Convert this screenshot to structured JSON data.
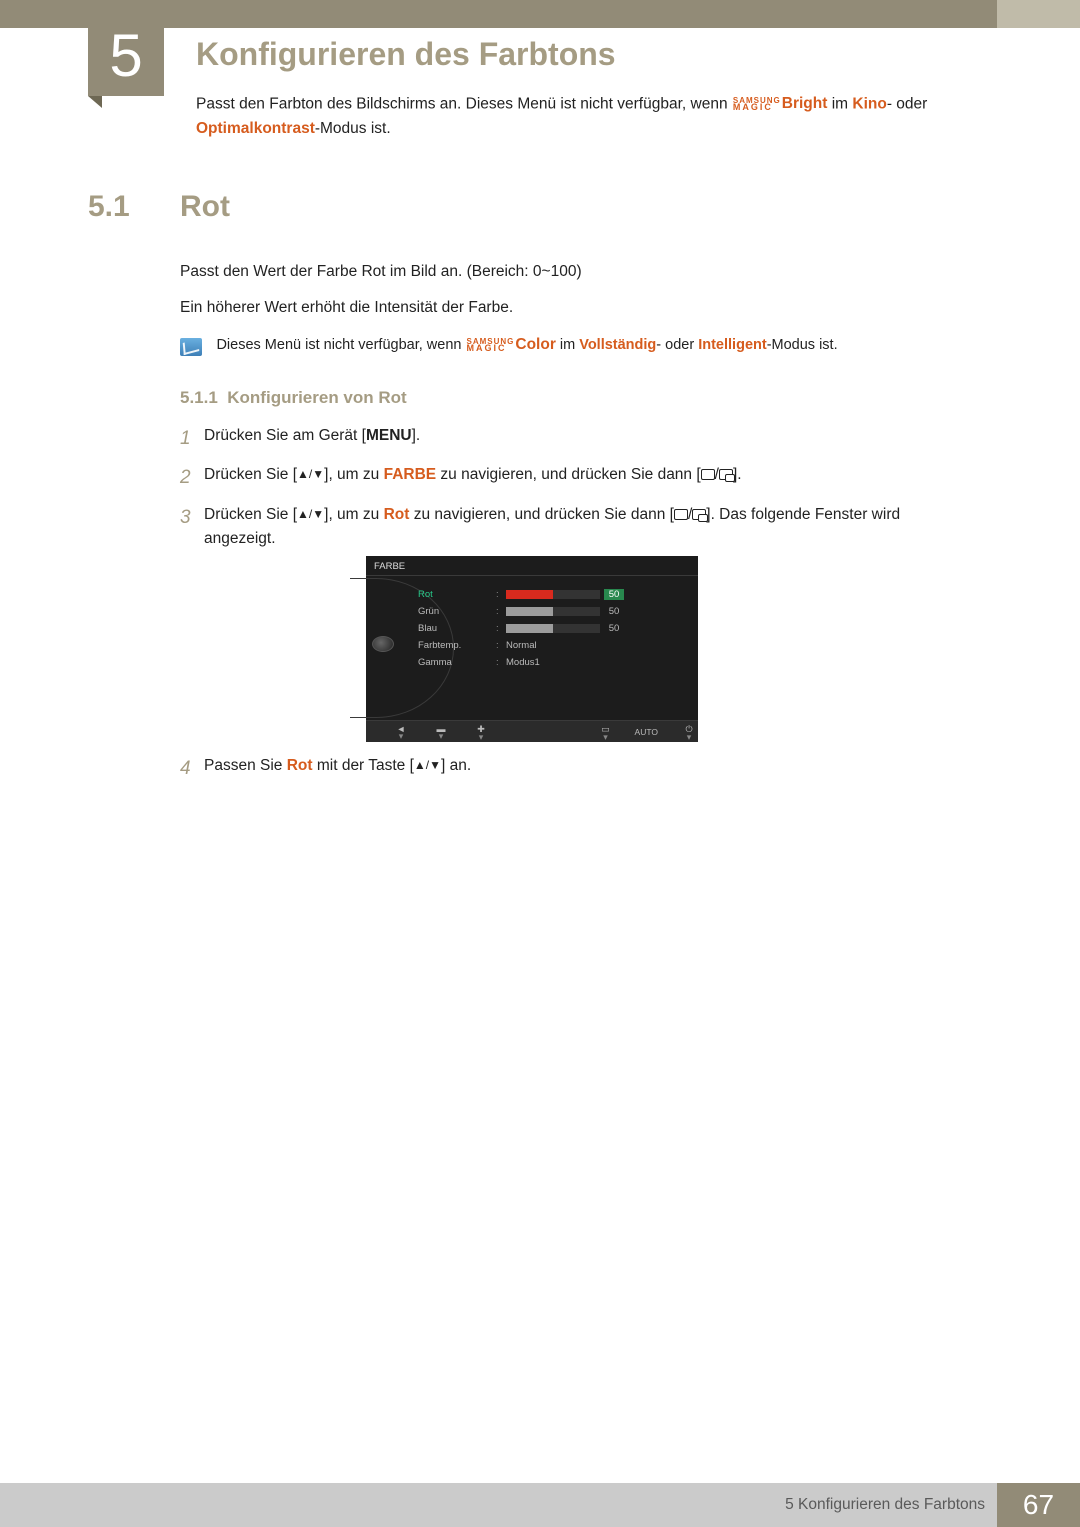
{
  "chapter": {
    "number": "5",
    "title": "Konfigurieren des Farbtons"
  },
  "intro": {
    "t1": "Passt den Farbton des Bildschirms an. Dieses Menü ist nicht verfügbar, wenn ",
    "magic_label": "Bright",
    "t2": " im ",
    "kino": "Kino",
    "t3": "- oder ",
    "optimal": "Optimalkontrast",
    "t4": "-Modus ist."
  },
  "section": {
    "number": "5.1",
    "title": "Rot"
  },
  "p1": "Passt den Wert der Farbe Rot im Bild an. (Bereich: 0~100)",
  "p2": "Ein höherer Wert erhöht die Intensität der Farbe.",
  "note": {
    "t1": "Dieses Menü ist nicht verfügbar, wenn ",
    "magic_label": "Color",
    "t2": " im ",
    "voll": "Vollständig",
    "t3": "- oder ",
    "intel": "Intelligent",
    "t4": "-Modus ist."
  },
  "subsec": {
    "number": "5.1.1",
    "title": "Konfigurieren von Rot"
  },
  "steps": {
    "s1a": "Drücken Sie am Gerät [",
    "s1menu": "MENU",
    "s1b": "].",
    "s2a": "Drücken Sie [",
    "s2b": "], um zu ",
    "s2farbe": "FARBE",
    "s2c": " zu navigieren, und drücken Sie dann [",
    "s2d": "].",
    "s3a": "Drücken Sie [",
    "s3b": "], um zu ",
    "s3rot": "Rot",
    "s3c": " zu navigieren, und drücken Sie dann [",
    "s3d": "]. Das folgende Fenster wird angezeigt.",
    "s4a": "Passen Sie ",
    "s4rot": "Rot",
    "s4b": " mit der Taste [",
    "s4c": "] an."
  },
  "osd": {
    "title": "FARBE",
    "rows": [
      {
        "label": "Rot",
        "type": "bar",
        "value": "50",
        "fill": 50,
        "color": "#d82a1e",
        "selected": true
      },
      {
        "label": "Grün",
        "type": "bar",
        "value": "50",
        "fill": 50,
        "color": "#9c9c9c",
        "selected": false
      },
      {
        "label": "Blau",
        "type": "bar",
        "value": "50",
        "fill": 50,
        "color": "#9c9c9c",
        "selected": false
      },
      {
        "label": "Farbtemp.",
        "type": "text",
        "text": "Normal"
      },
      {
        "label": "Gamma",
        "type": "text",
        "text": "Modus1"
      }
    ],
    "auto": "AUTO"
  },
  "footer": {
    "text": "5 Konfigurieren des Farbtons",
    "page": "67"
  },
  "magic_top": "SAMSUNG",
  "magic_bot": "MAGIC"
}
